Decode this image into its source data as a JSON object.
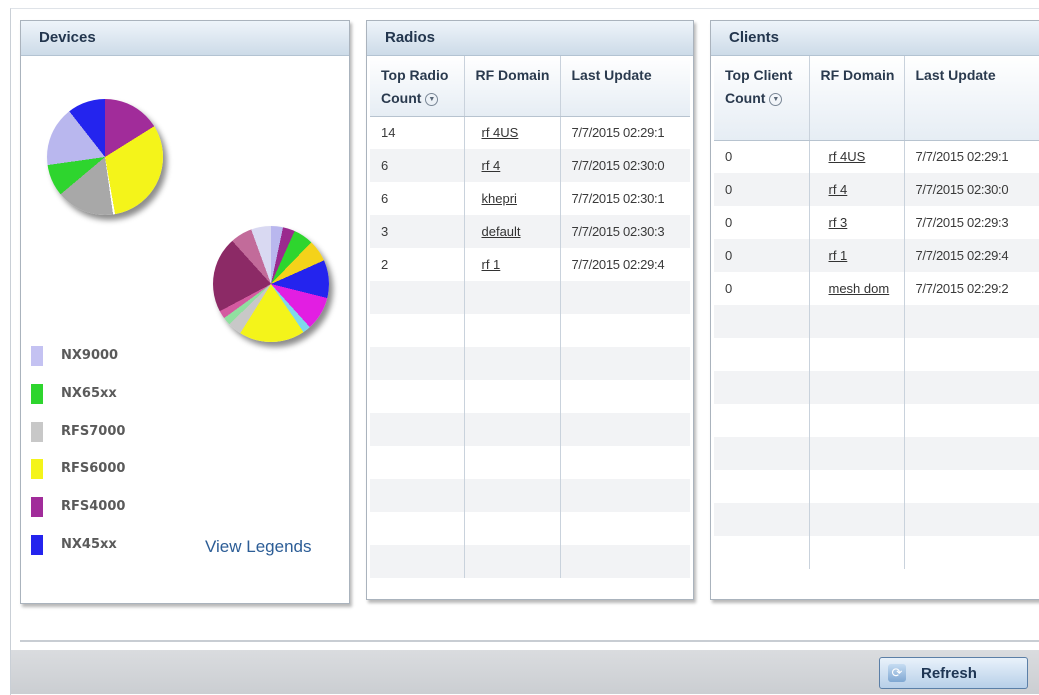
{
  "devices": {
    "title": "Devices",
    "legend": [
      {
        "label": "NX9000",
        "color": "#c4c2f2"
      },
      {
        "label": "NX65xx",
        "color": "#2ed52e"
      },
      {
        "label": "RFS7000",
        "color": "#c8c8c8"
      },
      {
        "label": "RFS6000",
        "color": "#f4f41a"
      },
      {
        "label": "RFS4000",
        "color": "#a12c9a"
      },
      {
        "label": "NX45xx",
        "color": "#2424ee"
      }
    ],
    "view_legends": "View Legends"
  },
  "radios": {
    "title": "Radios",
    "columns": [
      "Top Radio Count",
      "RF Domain",
      "Last Update"
    ],
    "rows": [
      [
        "14",
        "rf 4US",
        "7/7/2015 02:29:1"
      ],
      [
        "6",
        "rf 4",
        "7/7/2015 02:30:0"
      ],
      [
        "6",
        "khepri",
        "7/7/2015 02:30:1"
      ],
      [
        "3",
        "default",
        "7/7/2015 02:30:3"
      ],
      [
        "2",
        "rf 1",
        "7/7/2015 02:29:4"
      ]
    ]
  },
  "clients": {
    "title": "Clients",
    "columns": [
      "Top Client Count",
      "RF Domain",
      "Last Update"
    ],
    "rows": [
      [
        "0",
        "rf 4US",
        "7/7/2015 02:29:1"
      ],
      [
        "0",
        "rf 4",
        "7/7/2015 02:30:0"
      ],
      [
        "0",
        "rf 3",
        "7/7/2015 02:29:3"
      ],
      [
        "0",
        "rf 1",
        "7/7/2015 02:29:4"
      ],
      [
        "0",
        "mesh dom",
        "7/7/2015 02:29:2"
      ]
    ]
  },
  "footer": {
    "refresh_label": "Refresh"
  }
}
